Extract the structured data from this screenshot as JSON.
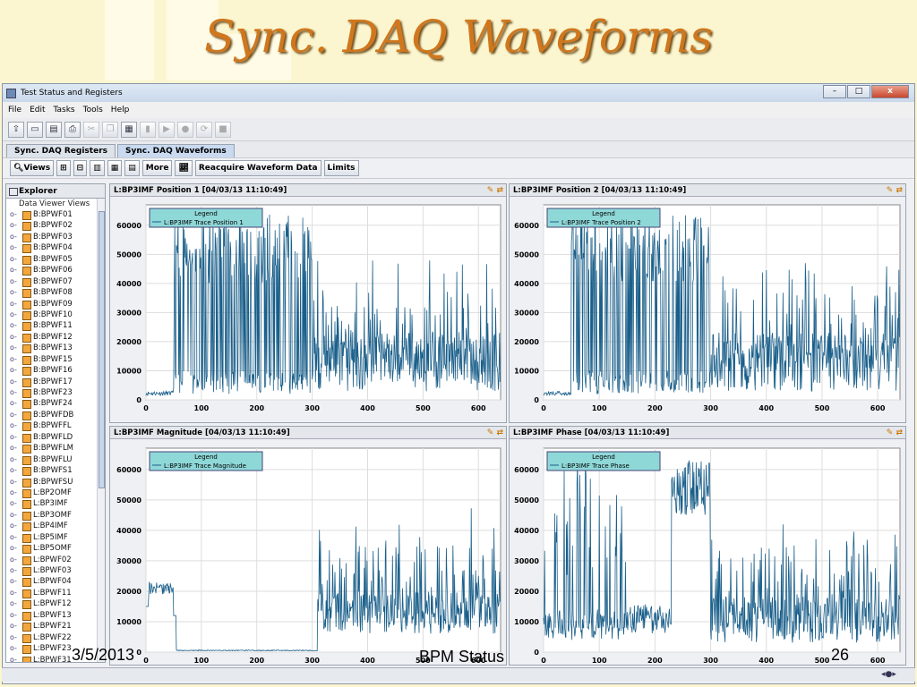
{
  "slide": {
    "title": "Sync. DAQ Waveforms",
    "date": "3/5/2013",
    "footer": "BPM Status",
    "page": "26"
  },
  "window": {
    "title": "Test Status and Registers",
    "menu": [
      "File",
      "Edit",
      "Tasks",
      "Tools",
      "Help"
    ],
    "tabs": [
      "Sync. DAQ Registers",
      "Sync. DAQ Waveforms"
    ],
    "active_tab": "Sync. DAQ Waveforms"
  },
  "view_toolbar": {
    "views": "Views",
    "more": "More",
    "reacquire": "Reacquire Waveform Data",
    "limits": "Limits"
  },
  "explorer": {
    "title": "Explorer",
    "root": "Data Viewer Views",
    "items": [
      "B:BPWF01",
      "B:BPWF02",
      "B:BPWF03",
      "B:BPWF04",
      "B:BPWF05",
      "B:BPWF06",
      "B:BPWF07",
      "B:BPWF08",
      "B:BPWF09",
      "B:BPWF10",
      "B:BPWF11",
      "B:BPWF12",
      "B:BPWF13",
      "B:BPWF15",
      "B:BPWF16",
      "B:BPWF17",
      "B:BPWF23",
      "B:BPWF24",
      "B:BPWFDB",
      "B:BPWFFL",
      "B:BPWFLD",
      "B:BPWFLM",
      "B:BPWFLU",
      "B:BPWFS1",
      "B:BPWFSU",
      "L:BP2OMF",
      "L:BP3IMF",
      "L:BP3OMF",
      "L:BP4IMF",
      "L:BP5IMF",
      "L:BP5OMF",
      "L:BPWF02",
      "L:BPWF03",
      "L:BPWF04",
      "L:BPWF11",
      "L:BPWF12",
      "L:BPWF13",
      "L:BPWF21",
      "L:BPWF22",
      "L:BPWF23",
      "L:BPWF31"
    ]
  },
  "panels": [
    {
      "title": "L:BP3IMF Position 1  [04/03/13 11:10:49]",
      "legend_title": "Legend",
      "legend": "L:BP3IMF Trace Position 1"
    },
    {
      "title": "L:BP3IMF Position 2  [04/03/13 11:10:49]",
      "legend_title": "Legend",
      "legend": "L:BP3IMF Trace Position 2"
    },
    {
      "title": "L:BP3IMF Magnitude  [04/03/13 11:10:49]",
      "legend_title": "Legend",
      "legend": "L:BP3IMF Trace Magnitude"
    },
    {
      "title": "L:BP3IMF Phase  [04/03/13 11:10:49]",
      "legend_title": "Legend",
      "legend": "L:BP3IMF Trace Phase"
    }
  ],
  "axes": {
    "x_ticks": [
      "0",
      "100",
      "200",
      "300",
      "400",
      "500",
      "600"
    ],
    "y_ticks": [
      "0",
      "10000",
      "20000",
      "30000",
      "40000",
      "50000",
      "60000"
    ],
    "xlim": [
      0,
      640
    ],
    "ylim": [
      0,
      67000
    ]
  },
  "colors": {
    "trace": "#1a5f8a",
    "legend_bg": "#8fd8d8",
    "slide_title": "#d0771d"
  }
}
